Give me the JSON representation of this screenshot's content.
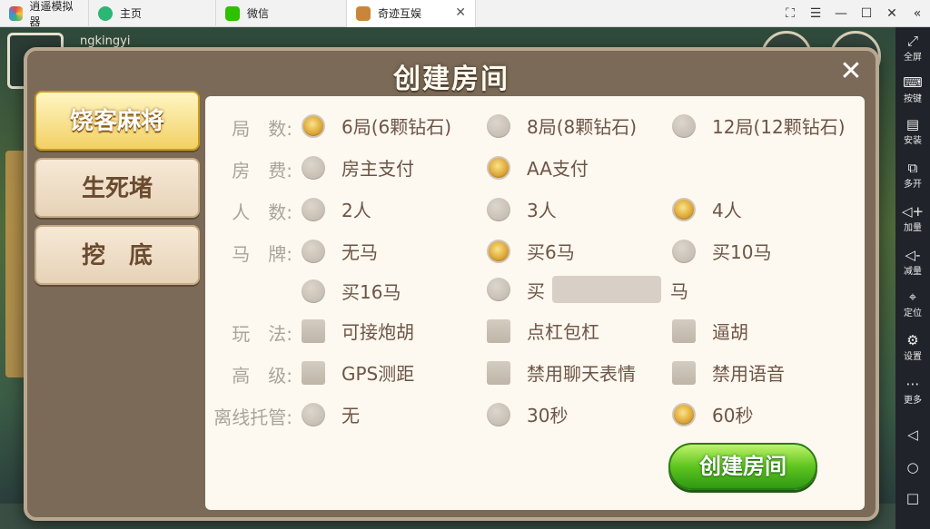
{
  "window": {
    "tabs": [
      {
        "label": "逍遥模拟器"
      },
      {
        "label": "主页"
      },
      {
        "label": "微信"
      },
      {
        "label": "奇迹互娱"
      }
    ],
    "controls": [
      "⛶",
      "☰",
      "—",
      "☐",
      "✕",
      "«"
    ]
  },
  "sidepanel": {
    "items": [
      {
        "glyph": "⤢",
        "label": "全屏"
      },
      {
        "glyph": "⌨",
        "label": "按键"
      },
      {
        "glyph": "▤",
        "label": "安装"
      },
      {
        "glyph": "⧉",
        "label": "多开"
      },
      {
        "glyph": "◁+",
        "label": "加量"
      },
      {
        "glyph": "◁-",
        "label": "减量"
      },
      {
        "glyph": "⌖",
        "label": "定位"
      },
      {
        "glyph": "⚙",
        "label": "设置"
      },
      {
        "glyph": "⋯",
        "label": "更多"
      }
    ],
    "nav": [
      "◁",
      "○",
      "□"
    ]
  },
  "background": {
    "username": "ngkingyi"
  },
  "dialog": {
    "title": "创建房间",
    "close": "✕",
    "tabs": [
      {
        "label": "饶客麻将",
        "active": true
      },
      {
        "label": "生死堵",
        "active": false
      },
      {
        "label": "挖　底",
        "active": false
      }
    ],
    "rows": {
      "rounds": {
        "label": "局　数:",
        "options": [
          {
            "text": "6局(6颗钻石)",
            "selected": true
          },
          {
            "text": "8局(8颗钻石)",
            "selected": false
          },
          {
            "text": "12局(12颗钻石)",
            "selected": false
          }
        ]
      },
      "fee": {
        "label": "房　费:",
        "options": [
          {
            "text": "房主支付",
            "selected": false
          },
          {
            "text": "AA支付",
            "selected": true
          }
        ]
      },
      "players": {
        "label": "人　数:",
        "options": [
          {
            "text": "2人",
            "selected": false
          },
          {
            "text": "3人",
            "selected": false
          },
          {
            "text": "4人",
            "selected": true
          }
        ]
      },
      "horse": {
        "label": "马　牌:",
        "options": [
          {
            "text": "无马",
            "selected": false
          },
          {
            "text": "买6马",
            "selected": true
          },
          {
            "text": "买10马",
            "selected": false
          },
          {
            "text": "买16马",
            "selected": false
          }
        ],
        "custom": {
          "prefix": "买",
          "suffix": "马",
          "selected": false
        }
      },
      "rules": {
        "label": "玩　法:",
        "options": [
          {
            "text": "可接炮胡",
            "checked": false
          },
          {
            "text": "点杠包杠",
            "checked": false
          },
          {
            "text": "逼胡",
            "checked": false
          }
        ]
      },
      "advanced": {
        "label": "高　级:",
        "options": [
          {
            "text": "GPS测距",
            "checked": false
          },
          {
            "text": "禁用聊天表情",
            "checked": false
          },
          {
            "text": "禁用语音",
            "checked": false
          }
        ]
      },
      "offline": {
        "label": "离线托管:",
        "options": [
          {
            "text": "无",
            "selected": false
          },
          {
            "text": "30秒",
            "selected": false
          },
          {
            "text": "60秒",
            "selected": true
          }
        ]
      }
    },
    "create_label": "创建房间"
  },
  "colors": {
    "accent_gold": "#e0a93a",
    "create_green": "#5fc51f",
    "panel_bg": "#fdf8f0",
    "frame": "#7a6a57"
  }
}
